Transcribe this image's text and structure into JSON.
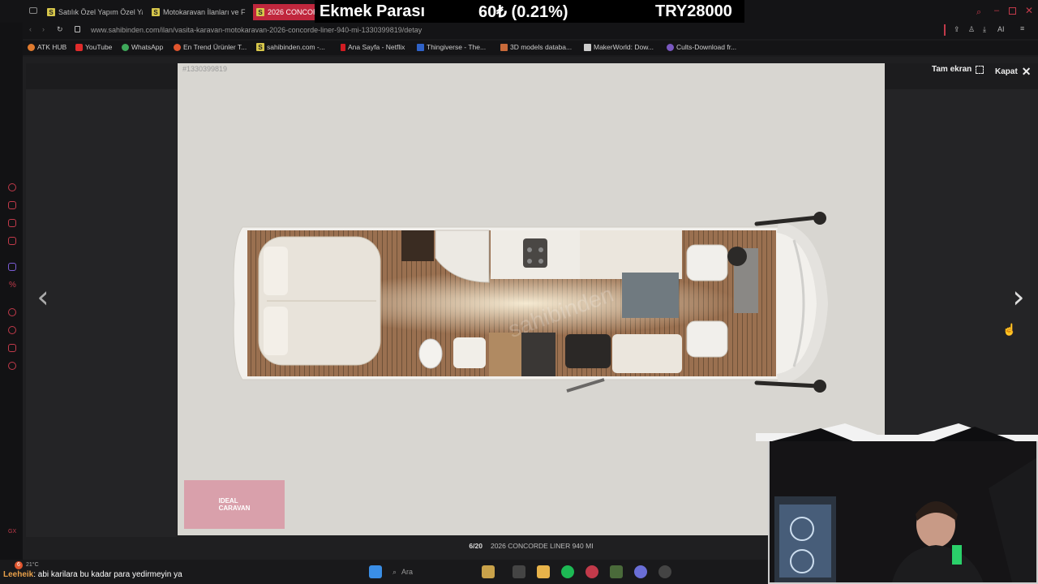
{
  "browser": {
    "tabs": [
      {
        "label": "Satılık Özel Yapım Özel Yap"
      },
      {
        "label": "Motokaravan İlanları ve Fiy"
      },
      {
        "label": "2026 CONCORDE"
      }
    ],
    "url": "www.sahibinden.com/ilan/vasita-karavan-motokaravan-2026-concorde-liner-940-mi-1330399819/detay",
    "bookmarks": [
      {
        "label": "ATK HUB",
        "color": "#e07a2e"
      },
      {
        "label": "YouTube",
        "color": "#e02b2b"
      },
      {
        "label": "WhatsApp",
        "color": "#3ea85a"
      },
      {
        "label": "En Trend Ürünler T...",
        "color": "#e0552e"
      },
      {
        "label": "sahibinden.com -...",
        "color": "#d6c64a"
      },
      {
        "label": "Ana Sayfa - Netflix",
        "color": "#d01c22"
      },
      {
        "label": "Thingiverse - The...",
        "color": "#2f62c8"
      },
      {
        "label": "3D models databa...",
        "color": "#c86a3a"
      },
      {
        "label": "MakerWorld: Dow...",
        "color": "#cccccc"
      },
      {
        "label": "Cults-Download fr...",
        "color": "#7a58c0"
      }
    ],
    "address_icons": "AI"
  },
  "ticker": {
    "label": "Ekmek Parası",
    "change": "60₺ (0.21%)",
    "amount": "TRY28000"
  },
  "gallery": {
    "listing_id": "#1330399819",
    "fullscreen_label": "Tam ekran",
    "close_label": "Kapat",
    "counter": "6/20",
    "title": "2026 CONCORDE LINER 940 MI",
    "logo_text_line1": "IDEAL",
    "logo_text_line2": "CARAVAN",
    "watermark": "sahibinden"
  },
  "taskbar": {
    "search_placeholder": "Ara",
    "weather": "21°C",
    "chat_user": "Leeheik",
    "chat_message": ": abi karilara bu kadar para yedirmeyin ya",
    "notification_count": "6"
  }
}
